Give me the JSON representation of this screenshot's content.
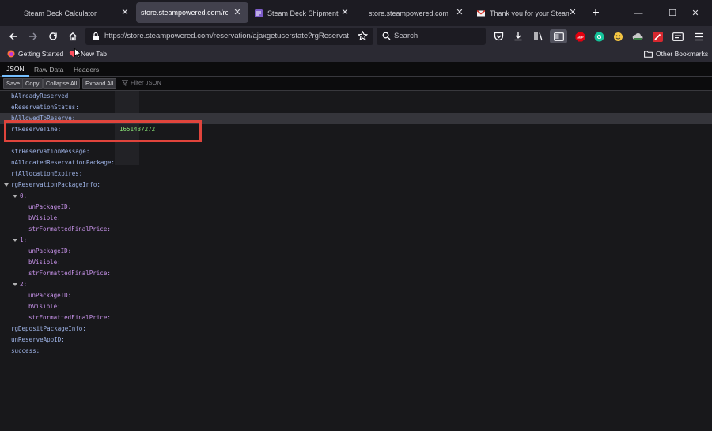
{
  "tabs": [
    {
      "title": "Steam Deck Calculator",
      "favicon": "blank",
      "active": false
    },
    {
      "title": "store.steampowered.com/reserv",
      "favicon": "none",
      "active": true
    },
    {
      "title": "Steam Deck Shipment estim",
      "favicon": "purple-doc",
      "active": false
    },
    {
      "title": "store.steampowered.com/reser",
      "favicon": "none",
      "active": false
    },
    {
      "title": "Thank you for your Steam p",
      "favicon": "gmail",
      "active": false
    }
  ],
  "window_controls": {
    "minimize": "—",
    "maximize": "☐",
    "close": "✕"
  },
  "nav": {
    "url": "https://store.steampowered.com/reservation/ajaxgetuserstate?rgReservat",
    "search_placeholder": "Search"
  },
  "bookmarks": {
    "items": [
      "Getting Started",
      "New Tab"
    ],
    "other": "Other Bookmarks"
  },
  "viewer_tabs": [
    "JSON",
    "Raw Data",
    "Headers"
  ],
  "json_toolbar": {
    "save": "Save",
    "copy": "Copy",
    "collapse_all": "Collapse All",
    "expand_all": "Expand All",
    "filter_placeholder": "Filter JSON"
  },
  "json_rows": [
    {
      "key": "bAlreadyReserved:",
      "indent": 0,
      "value": ""
    },
    {
      "key": "eReservationStatus:",
      "indent": 0,
      "value": ""
    },
    {
      "key": "bAllowedToReserve:",
      "indent": 0,
      "value": ""
    },
    {
      "key": "rtReserveTime:",
      "indent": 0,
      "value": "1651437272"
    },
    {
      "key": "",
      "indent": 0,
      "value": ""
    },
    {
      "key": "strReservationMessage:",
      "indent": 0,
      "value": ""
    },
    {
      "key": "nAllocatedReservationPackage:",
      "indent": 0,
      "value": ""
    },
    {
      "key": "rtAllocationExpires:",
      "indent": 0,
      "value": ""
    },
    {
      "key": "rgReservationPackageInfo:",
      "indent": 0,
      "value": "",
      "expanded": true
    },
    {
      "key": "0:",
      "indent": 1,
      "value": "",
      "expanded": true
    },
    {
      "key": "unPackageID:",
      "indent": 2,
      "value": ""
    },
    {
      "key": "bVisible:",
      "indent": 2,
      "value": ""
    },
    {
      "key": "strFormattedFinalPrice:",
      "indent": 2,
      "value": ""
    },
    {
      "key": "1:",
      "indent": 1,
      "value": "",
      "expanded": true
    },
    {
      "key": "unPackageID:",
      "indent": 2,
      "value": ""
    },
    {
      "key": "bVisible:",
      "indent": 2,
      "value": ""
    },
    {
      "key": "strFormattedFinalPrice:",
      "indent": 2,
      "value": ""
    },
    {
      "key": "2:",
      "indent": 1,
      "value": "",
      "expanded": true
    },
    {
      "key": "unPackageID:",
      "indent": 2,
      "value": ""
    },
    {
      "key": "bVisible:",
      "indent": 2,
      "value": ""
    },
    {
      "key": "strFormattedFinalPrice:",
      "indent": 2,
      "value": ""
    },
    {
      "key": "rgDepositPackageInfo:",
      "indent": 0,
      "value": ""
    },
    {
      "key": "unReserveAppID:",
      "indent": 0,
      "value": ""
    },
    {
      "key": "success:",
      "indent": 0,
      "value": ""
    }
  ],
  "colors": {
    "highlight_box": "#e0443c",
    "accent": "#75bfff"
  }
}
